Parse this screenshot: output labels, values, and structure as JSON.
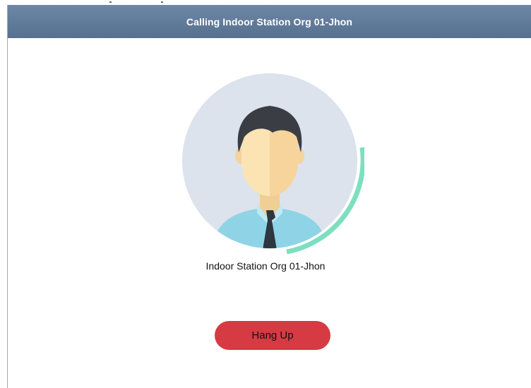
{
  "dialog": {
    "title": "Calling Indoor Station Org 01-Jhon",
    "callee_name": "Indoor Station Org 01-Jhon",
    "hangup_label": "Hang Up"
  },
  "avatar": {
    "icon": "user-avatar-icon",
    "ring_icon": "calling-progress-ring-icon"
  },
  "colors": {
    "title_bar": "#5f7896",
    "avatar_bg": "#dce3ec",
    "progress_ring": "#7ddfc0",
    "hangup_button": "#d63a43"
  }
}
